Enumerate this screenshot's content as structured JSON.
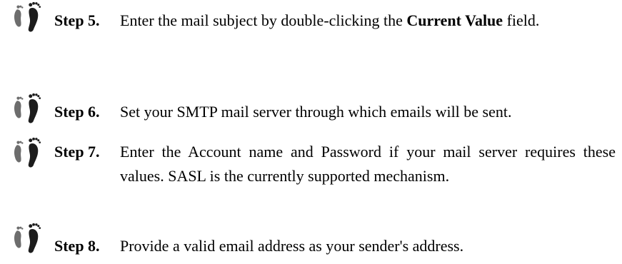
{
  "icon": "footprints-icon",
  "steps": [
    {
      "label": "Step 5.",
      "text_before": "Enter the mail subject by double-clicking the ",
      "text_bold": "Current Value",
      "text_after": " field."
    },
    {
      "label": "Step 6.",
      "text": "Set your SMTP mail server through which emails will be sent."
    },
    {
      "label": "Step 7.",
      "text": "Enter the Account name and Password if your mail server requires these values. SASL is the currently supported mechanism."
    },
    {
      "label": "Step 8.",
      "text": "Provide a valid email address as your sender's address."
    }
  ]
}
